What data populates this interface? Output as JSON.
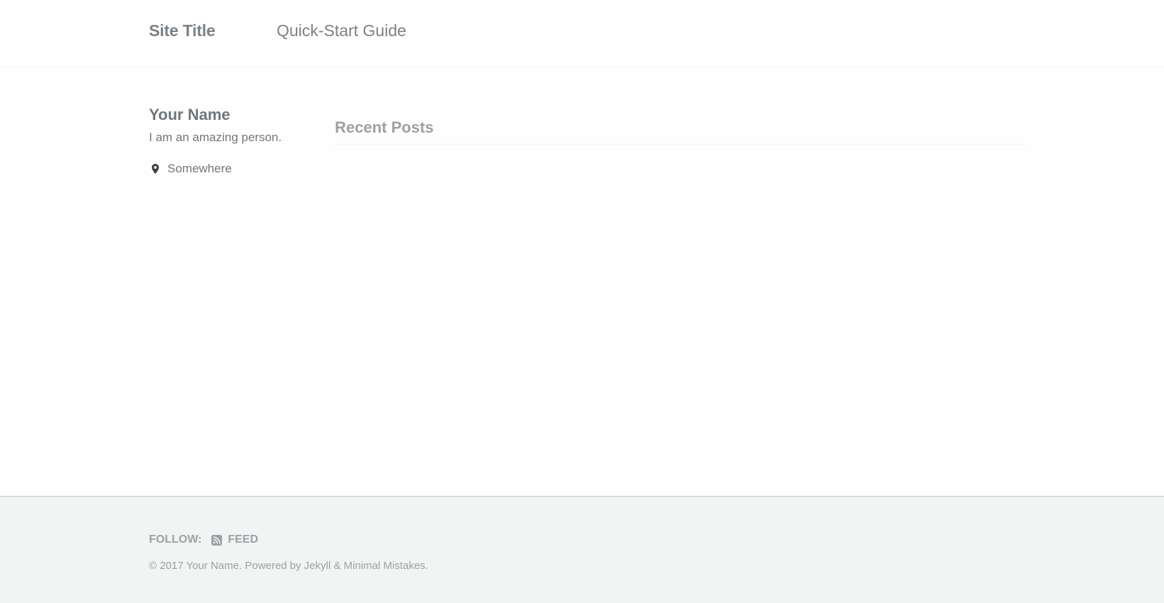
{
  "header": {
    "site_title": "Site Title",
    "nav_items": [
      {
        "label": "Quick-Start Guide"
      }
    ]
  },
  "sidebar": {
    "author_name": "Your Name",
    "author_bio": "I am an amazing person.",
    "location": "Somewhere",
    "location_icon": "map-marker-icon"
  },
  "main": {
    "recent_posts_heading": "Recent Posts"
  },
  "footer": {
    "follow_label": "Follow:",
    "feed_label": "Feed",
    "feed_icon": "rss-square-icon",
    "copyright": "© 2017 Your Name. Powered by Jekyll & Minimal Mistakes."
  },
  "colors": {
    "text": "#6f777d",
    "muted": "#9ba1a6",
    "footer_bg": "#f2f3f3",
    "border": "#c4c6c8"
  }
}
